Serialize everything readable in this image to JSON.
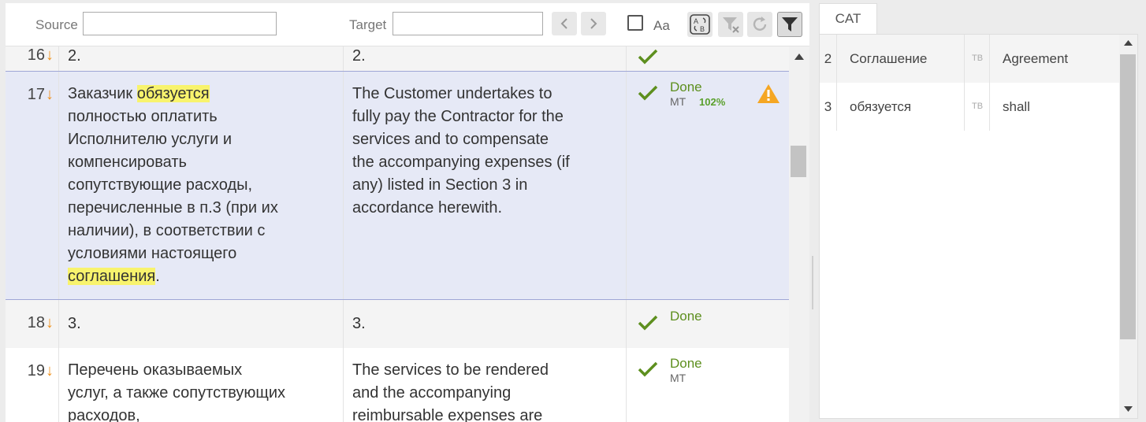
{
  "toolbar": {
    "source_label": "Source",
    "source_value": "",
    "target_label": "Target",
    "target_value": "",
    "case_label": "Aa"
  },
  "segments": [
    {
      "num": "16",
      "source": "2.",
      "target": "2.",
      "status": "",
      "origin": "",
      "match": ""
    },
    {
      "num": "17",
      "source_parts": [
        "Заказчик ",
        "обязуется",
        " полностью оплатить Исполнителю услуги и компенсировать сопутствующие расходы, перечисленные в п.3 (при их наличии), в соответствии с условиями настоящего ",
        "соглашения",
        "."
      ],
      "target": "The Customer undertakes to fully pay the Contractor for the services and to compensate the accompanying expenses (if any) listed in Section 3 in accordance herewith.",
      "status": "Done",
      "origin": "MT",
      "match": "102%"
    },
    {
      "num": "18",
      "source": "3.",
      "target": "3.",
      "status": "Done",
      "origin": "",
      "match": ""
    },
    {
      "num": "19",
      "source": "Перечень оказываемых услуг, а также сопутствующих расходов,",
      "target": "The services to be rendered and the accompanying reimbursable expenses are",
      "status": "Done",
      "origin": "MT",
      "match": ""
    }
  ],
  "cat": {
    "tab_label": "CAT",
    "rows": [
      {
        "num": "2",
        "source": "Соглашение",
        "type": "ТВ",
        "target": "Agreement"
      },
      {
        "num": "3",
        "source": "обязуется",
        "type": "ТВ",
        "target": "shall"
      }
    ]
  },
  "colors": {
    "highlight": "#f8f36d",
    "done_green": "#5d8f1e",
    "arrow_orange": "#f0921e",
    "warning": "#f5a623",
    "active_row": "#e6e9f6"
  }
}
